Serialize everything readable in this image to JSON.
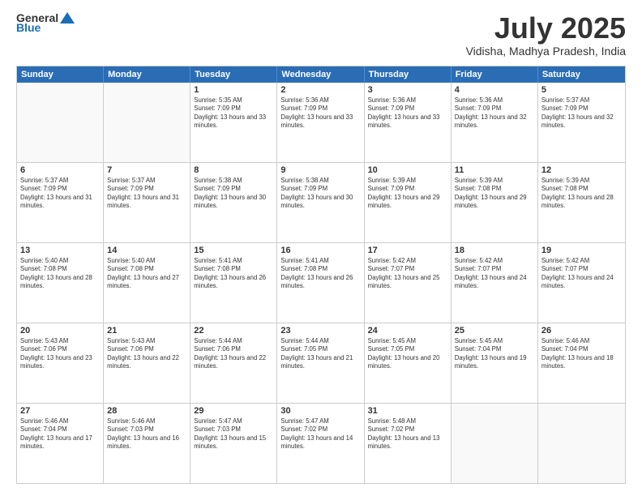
{
  "logo": {
    "general": "General",
    "blue": "Blue"
  },
  "title": "July 2025",
  "location": "Vidisha, Madhya Pradesh, India",
  "days_of_week": [
    "Sunday",
    "Monday",
    "Tuesday",
    "Wednesday",
    "Thursday",
    "Friday",
    "Saturday"
  ],
  "weeks": [
    [
      {
        "day": "",
        "info": ""
      },
      {
        "day": "",
        "info": ""
      },
      {
        "day": "1",
        "info": "Sunrise: 5:35 AM\nSunset: 7:09 PM\nDaylight: 13 hours and 33 minutes."
      },
      {
        "day": "2",
        "info": "Sunrise: 5:36 AM\nSunset: 7:09 PM\nDaylight: 13 hours and 33 minutes."
      },
      {
        "day": "3",
        "info": "Sunrise: 5:36 AM\nSunset: 7:09 PM\nDaylight: 13 hours and 33 minutes."
      },
      {
        "day": "4",
        "info": "Sunrise: 5:36 AM\nSunset: 7:09 PM\nDaylight: 13 hours and 32 minutes."
      },
      {
        "day": "5",
        "info": "Sunrise: 5:37 AM\nSunset: 7:09 PM\nDaylight: 13 hours and 32 minutes."
      }
    ],
    [
      {
        "day": "6",
        "info": "Sunrise: 5:37 AM\nSunset: 7:09 PM\nDaylight: 13 hours and 31 minutes."
      },
      {
        "day": "7",
        "info": "Sunrise: 5:37 AM\nSunset: 7:09 PM\nDaylight: 13 hours and 31 minutes."
      },
      {
        "day": "8",
        "info": "Sunrise: 5:38 AM\nSunset: 7:09 PM\nDaylight: 13 hours and 30 minutes."
      },
      {
        "day": "9",
        "info": "Sunrise: 5:38 AM\nSunset: 7:09 PM\nDaylight: 13 hours and 30 minutes."
      },
      {
        "day": "10",
        "info": "Sunrise: 5:39 AM\nSunset: 7:09 PM\nDaylight: 13 hours and 29 minutes."
      },
      {
        "day": "11",
        "info": "Sunrise: 5:39 AM\nSunset: 7:08 PM\nDaylight: 13 hours and 29 minutes."
      },
      {
        "day": "12",
        "info": "Sunrise: 5:39 AM\nSunset: 7:08 PM\nDaylight: 13 hours and 28 minutes."
      }
    ],
    [
      {
        "day": "13",
        "info": "Sunrise: 5:40 AM\nSunset: 7:08 PM\nDaylight: 13 hours and 28 minutes."
      },
      {
        "day": "14",
        "info": "Sunrise: 5:40 AM\nSunset: 7:08 PM\nDaylight: 13 hours and 27 minutes."
      },
      {
        "day": "15",
        "info": "Sunrise: 5:41 AM\nSunset: 7:08 PM\nDaylight: 13 hours and 26 minutes."
      },
      {
        "day": "16",
        "info": "Sunrise: 5:41 AM\nSunset: 7:08 PM\nDaylight: 13 hours and 26 minutes."
      },
      {
        "day": "17",
        "info": "Sunrise: 5:42 AM\nSunset: 7:07 PM\nDaylight: 13 hours and 25 minutes."
      },
      {
        "day": "18",
        "info": "Sunrise: 5:42 AM\nSunset: 7:07 PM\nDaylight: 13 hours and 24 minutes."
      },
      {
        "day": "19",
        "info": "Sunrise: 5:42 AM\nSunset: 7:07 PM\nDaylight: 13 hours and 24 minutes."
      }
    ],
    [
      {
        "day": "20",
        "info": "Sunrise: 5:43 AM\nSunset: 7:06 PM\nDaylight: 13 hours and 23 minutes."
      },
      {
        "day": "21",
        "info": "Sunrise: 5:43 AM\nSunset: 7:06 PM\nDaylight: 13 hours and 22 minutes."
      },
      {
        "day": "22",
        "info": "Sunrise: 5:44 AM\nSunset: 7:06 PM\nDaylight: 13 hours and 22 minutes."
      },
      {
        "day": "23",
        "info": "Sunrise: 5:44 AM\nSunset: 7:05 PM\nDaylight: 13 hours and 21 minutes."
      },
      {
        "day": "24",
        "info": "Sunrise: 5:45 AM\nSunset: 7:05 PM\nDaylight: 13 hours and 20 minutes."
      },
      {
        "day": "25",
        "info": "Sunrise: 5:45 AM\nSunset: 7:04 PM\nDaylight: 13 hours and 19 minutes."
      },
      {
        "day": "26",
        "info": "Sunrise: 5:46 AM\nSunset: 7:04 PM\nDaylight: 13 hours and 18 minutes."
      }
    ],
    [
      {
        "day": "27",
        "info": "Sunrise: 5:46 AM\nSunset: 7:04 PM\nDaylight: 13 hours and 17 minutes."
      },
      {
        "day": "28",
        "info": "Sunrise: 5:46 AM\nSunset: 7:03 PM\nDaylight: 13 hours and 16 minutes."
      },
      {
        "day": "29",
        "info": "Sunrise: 5:47 AM\nSunset: 7:03 PM\nDaylight: 13 hours and 15 minutes."
      },
      {
        "day": "30",
        "info": "Sunrise: 5:47 AM\nSunset: 7:02 PM\nDaylight: 13 hours and 14 minutes."
      },
      {
        "day": "31",
        "info": "Sunrise: 5:48 AM\nSunset: 7:02 PM\nDaylight: 13 hours and 13 minutes."
      },
      {
        "day": "",
        "info": ""
      },
      {
        "day": "",
        "info": ""
      }
    ]
  ]
}
